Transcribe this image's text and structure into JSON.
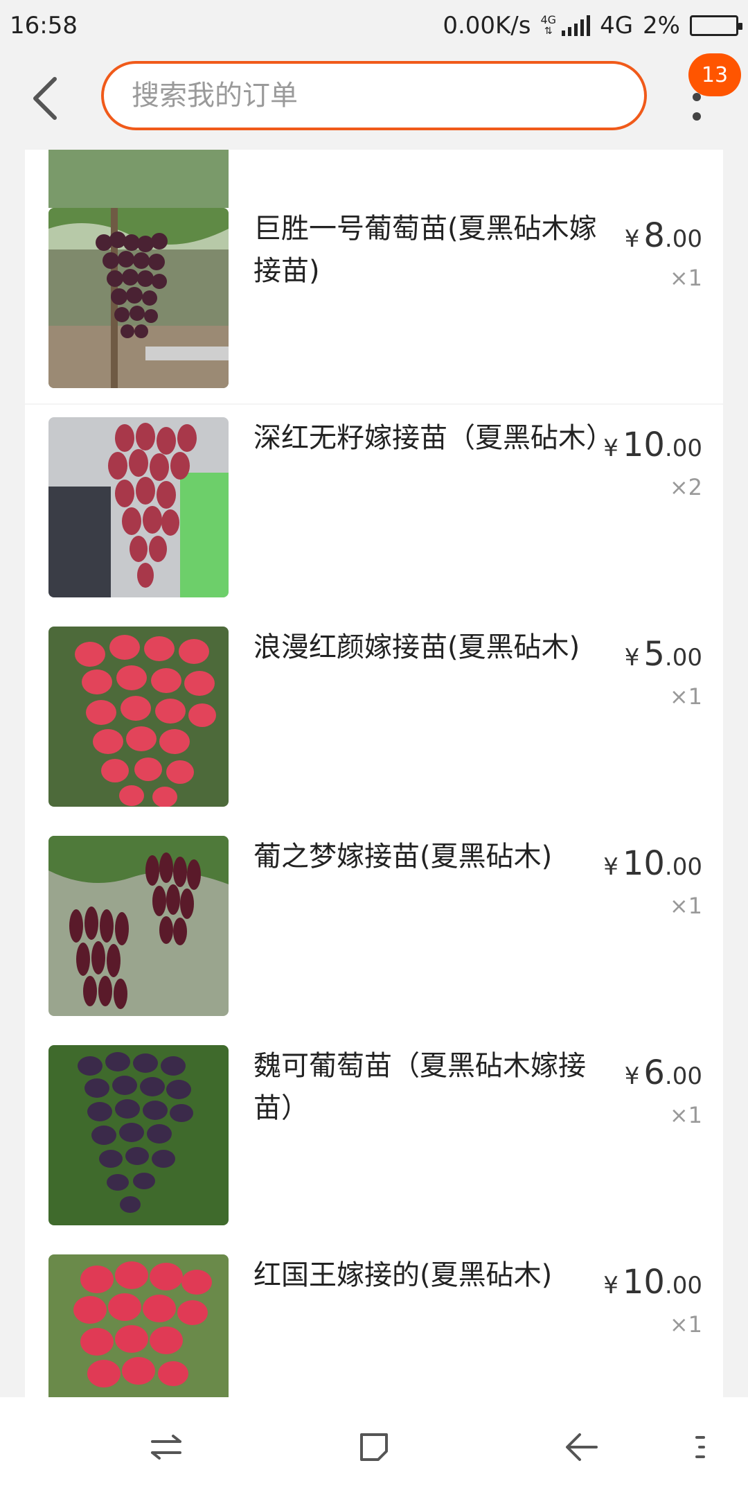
{
  "status_bar": {
    "time": "16:58",
    "speed": "0.00K/s",
    "net_small": "4G",
    "net": "4G",
    "battery": "2%"
  },
  "header": {
    "search_placeholder": "搜索我的订单",
    "badge_count": "13"
  },
  "items": [
    {
      "title": "巨胜一号葡萄苗(夏黑砧木嫁接苗)",
      "currency": "¥",
      "price_int": "8",
      "price_dec": ".00",
      "qty": "×1"
    },
    {
      "title": "深红无籽嫁接苗（夏黑砧木）",
      "currency": "¥",
      "price_int": "10",
      "price_dec": ".00",
      "qty": "×2"
    },
    {
      "title": "浪漫红颜嫁接苗(夏黑砧木)",
      "currency": "¥",
      "price_int": "5",
      "price_dec": ".00",
      "qty": "×1"
    },
    {
      "title": "葡之梦嫁接苗(夏黑砧木)",
      "currency": "¥",
      "price_int": "10",
      "price_dec": ".00",
      "qty": "×1"
    },
    {
      "title": "魏可葡萄苗（夏黑砧木嫁接苗）",
      "currency": "¥",
      "price_int": "6",
      "price_dec": ".00",
      "qty": "×1"
    },
    {
      "title": "红国王嫁接的(夏黑砧木)",
      "currency": "¥",
      "price_int": "10",
      "price_dec": ".00",
      "qty": "×1"
    }
  ],
  "colors": {
    "accent": "#f05a1a",
    "badge": "#ff5500"
  }
}
